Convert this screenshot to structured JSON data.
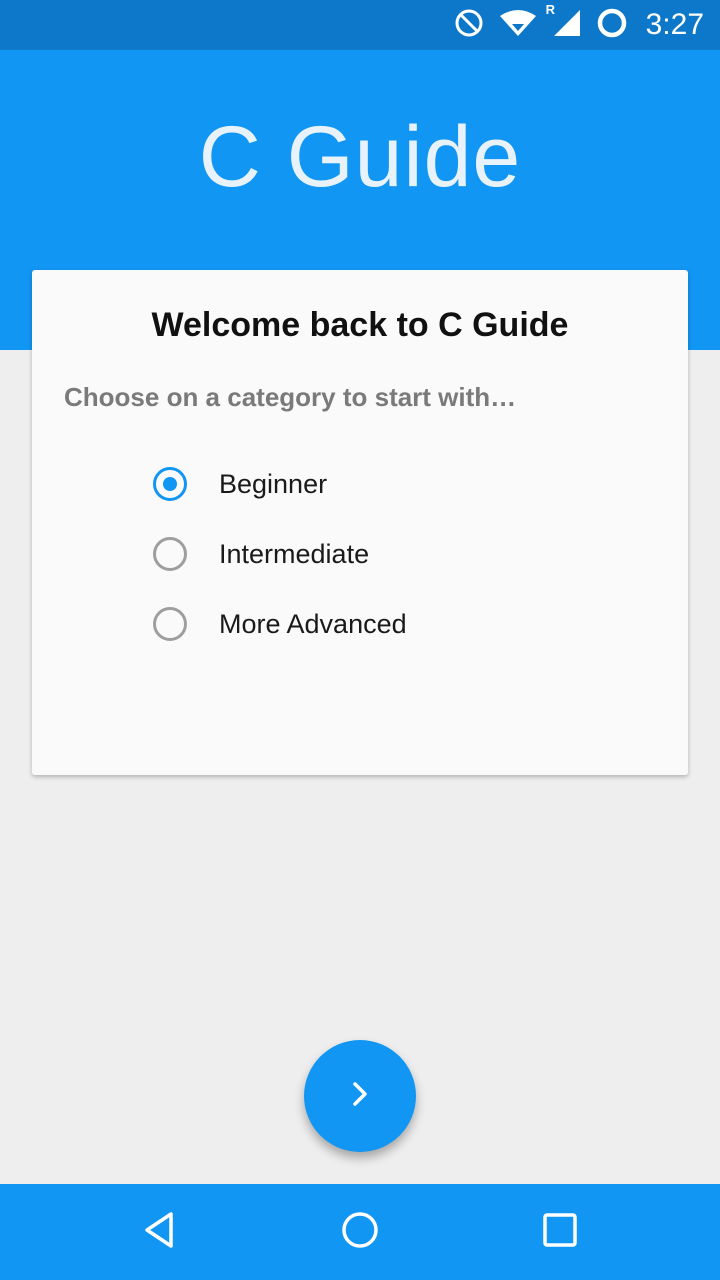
{
  "status_bar": {
    "time": "3:27",
    "roaming_label": "R",
    "icons": [
      "do-not-disturb-icon",
      "wifi-icon",
      "signal-icon",
      "battery-icon"
    ]
  },
  "header": {
    "app_title": "C Guide"
  },
  "card": {
    "title": "Welcome back to C Guide",
    "subtitle": "Choose on a category to start with…",
    "options": [
      {
        "label": "Beginner",
        "checked": true
      },
      {
        "label": "Intermediate",
        "checked": false
      },
      {
        "label": "More Advanced",
        "checked": false
      }
    ]
  },
  "fab": {
    "icon": "chevron-right-icon"
  },
  "nav_bar": {
    "icons": [
      "back-icon",
      "home-icon",
      "recents-icon"
    ]
  },
  "colors": {
    "primary": "#1196f3",
    "primary_dark": "#0d78c9",
    "background": "#eeeeee",
    "card": "#fafafa"
  }
}
